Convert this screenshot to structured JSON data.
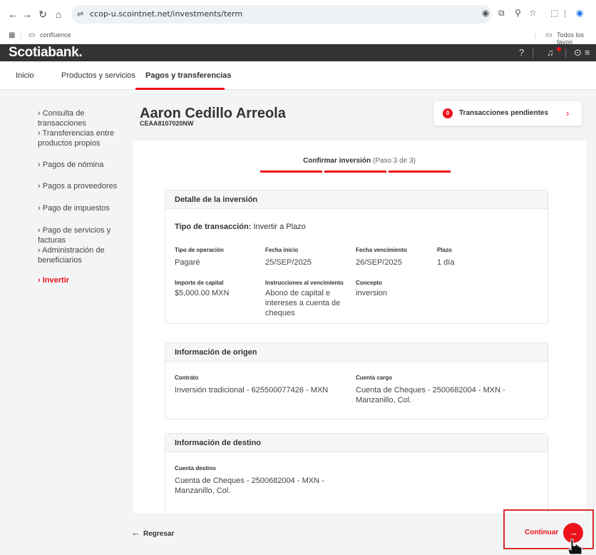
{
  "browser": {
    "url": "ccop-u.scointnet.net/investments/term",
    "bookmark_folder": "confluence",
    "all_bookmarks": "Todos los favori"
  },
  "header": {
    "logo": "Scotiabank."
  },
  "nav": {
    "tabs": [
      {
        "label": "Inicio"
      },
      {
        "label": "Productos y servicios"
      },
      {
        "label": "Pagos y transferencias"
      }
    ]
  },
  "sidebar": {
    "items": [
      {
        "label": "Consulta de transacciones"
      },
      {
        "label": "Transferencias entre productos propios"
      },
      {
        "label": "Pagos de nómina"
      },
      {
        "label": "Pagos a proveedores"
      },
      {
        "label": "Pago de impuestos"
      },
      {
        "label": "Pago de servicios y facturas"
      },
      {
        "label": "Administración de beneficiarios"
      },
      {
        "label": "Invertir"
      }
    ]
  },
  "client": {
    "name": "Aaron Cedillo Arreola",
    "id": "CEAA8107020NW"
  },
  "pending": {
    "count": "0",
    "label": "Transacciones pendientes"
  },
  "step": {
    "title": "Confirmar inversión",
    "progress": "(Paso 3 de 3)"
  },
  "detail": {
    "title": "Detalle de la inversión",
    "tx_type_label": "Tipo de transacción:",
    "tx_type_value": "Invertir a Plazo",
    "fields": {
      "op_type": {
        "label": "Tipo de operación",
        "value": "Pagaré"
      },
      "start_date": {
        "label": "Fecha inicio",
        "value": "25/SEP/2025"
      },
      "end_date": {
        "label": "Fecha vencimiento",
        "value": "26/SEP/2025"
      },
      "term": {
        "label": "Plazo",
        "value": "1 día"
      },
      "capital": {
        "label": "Importe de capital",
        "value": "$5,000.00 MXN"
      },
      "instructions": {
        "label": "Instrucciones al vencimiento",
        "value": "Abono de capital e intereses a cuenta de cheques"
      },
      "concept": {
        "label": "Concepto",
        "value": "inversion"
      }
    }
  },
  "origin": {
    "title": "Información de origen",
    "contract_label": "Contrato",
    "contract_value": "Inversión tradicional - 625500077426 - MXN",
    "charge_label": "Cuenta cargo",
    "charge_value": "Cuenta de Cheques - 2500682004 - MXN - Manzanillo, Col."
  },
  "destination": {
    "title": "Información de destino",
    "account_label": "Cuenta destino",
    "account_value": "Cuenta de Cheques - 2500682004 - MXN - Manzanillo, Col."
  },
  "footer": {
    "back_label": "Regresar",
    "continue_label": "Continuar"
  },
  "colors": {
    "brand_red": "#ec111a",
    "header_dark": "#333333"
  }
}
